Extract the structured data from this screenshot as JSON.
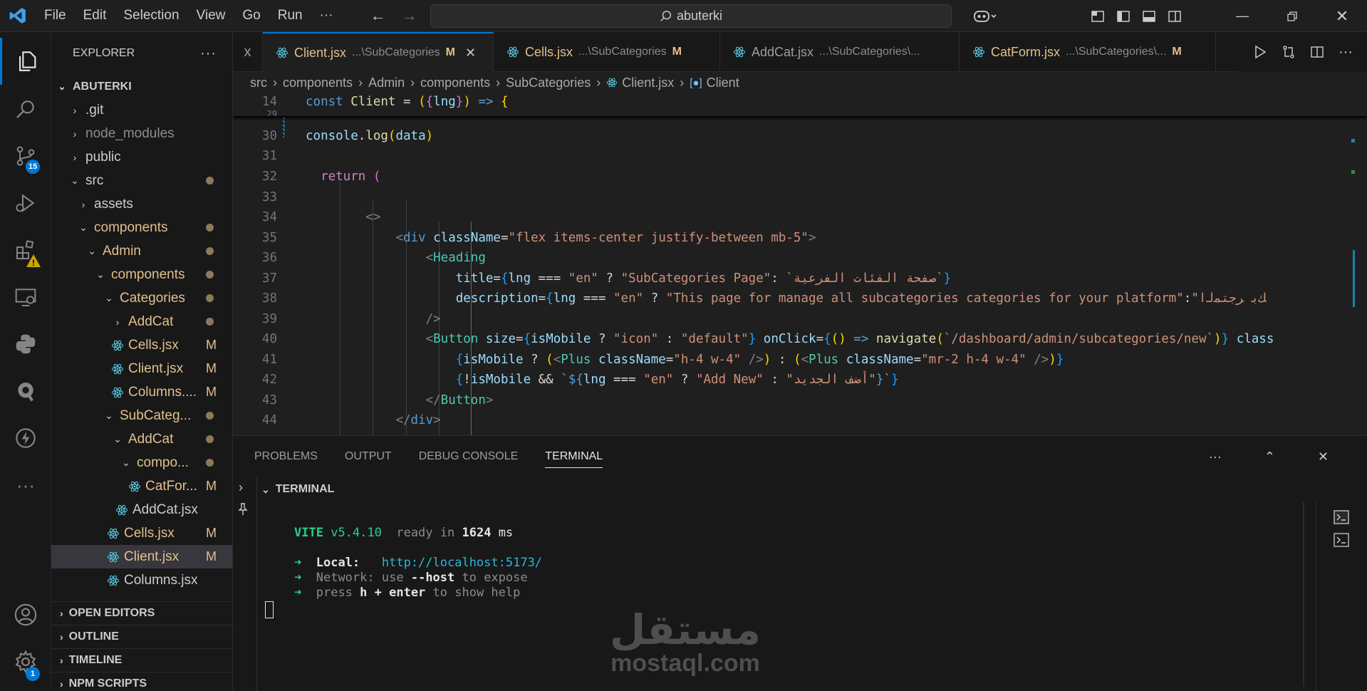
{
  "menu": {
    "items": [
      "File",
      "Edit",
      "Selection",
      "View",
      "Go",
      "Run",
      "···"
    ]
  },
  "search": {
    "text": "abuterki"
  },
  "activity": {
    "source_control_badge": "15",
    "settings_badge": "1"
  },
  "explorer": {
    "title": "EXPLORER",
    "root": "ABUTERKI",
    "items": [
      {
        "label": ".git"
      },
      {
        "label": "node_modules"
      },
      {
        "label": "public"
      },
      {
        "label": "src"
      },
      {
        "label": "assets"
      },
      {
        "label": "components"
      },
      {
        "label": "Admin"
      },
      {
        "label": "components"
      },
      {
        "label": "Categories"
      },
      {
        "label": "AddCat"
      },
      {
        "label": "Cells.jsx",
        "badge": "M"
      },
      {
        "label": "Client.jsx",
        "badge": "M"
      },
      {
        "label": "Columns....",
        "badge": "M"
      },
      {
        "label": "SubCateg..."
      },
      {
        "label": "AddCat"
      },
      {
        "label": "compo..."
      },
      {
        "label": "CatFor...",
        "badge": "M"
      },
      {
        "label": "AddCat.jsx"
      },
      {
        "label": "Cells.jsx",
        "badge": "M"
      },
      {
        "label": "Client.jsx",
        "badge": "M"
      },
      {
        "label": "Columns.jsx"
      }
    ],
    "sections": [
      "OPEN EDITORS",
      "OUTLINE",
      "TIMELINE",
      "NPM SCRIPTS"
    ]
  },
  "tabs": [
    {
      "name": "x",
      "path": ""
    },
    {
      "name": "Client.jsx",
      "path": "...\\SubCategories",
      "badge": "M"
    },
    {
      "name": "Cells.jsx",
      "path": "...\\SubCategories",
      "badge": "M"
    },
    {
      "name": "AddCat.jsx",
      "path": "...\\SubCategories\\..."
    },
    {
      "name": "CatForm.jsx",
      "path": "...\\SubCategories\\...",
      "badge": "M"
    }
  ],
  "breadcrumb": [
    "src",
    "components",
    "Admin",
    "components",
    "SubCategories",
    "Client.jsx",
    "Client"
  ],
  "code": {
    "sticky": {
      "line": "14",
      "text": "const Client = ({lng}) => {"
    },
    "sticky_next": "29",
    "lines": [
      "30",
      "31",
      "32",
      "33",
      "34",
      "35",
      "36",
      "37",
      "38",
      "39",
      "40",
      "41",
      "42",
      "43",
      "44"
    ]
  },
  "panel": {
    "tabs": [
      "PROBLEMS",
      "OUTPUT",
      "DEBUG CONSOLE",
      "TERMINAL"
    ],
    "terminal_title": "TERMINAL",
    "vite": {
      "name": "VITE",
      "version": "v5.4.10",
      "ready": "ready in",
      "ms": "1624",
      "unit": "ms"
    },
    "local_label": "Local:",
    "local_url": "http://localhost:5173/",
    "network_label": "Network:",
    "network_text1": "use",
    "network_flag": "--host",
    "network_text2": "to expose",
    "help_text1": "press",
    "help_key": "h + enter",
    "help_text2": "to show help"
  },
  "watermark": {
    "arabic": "مستقل",
    "latin": "mostaql.com"
  }
}
